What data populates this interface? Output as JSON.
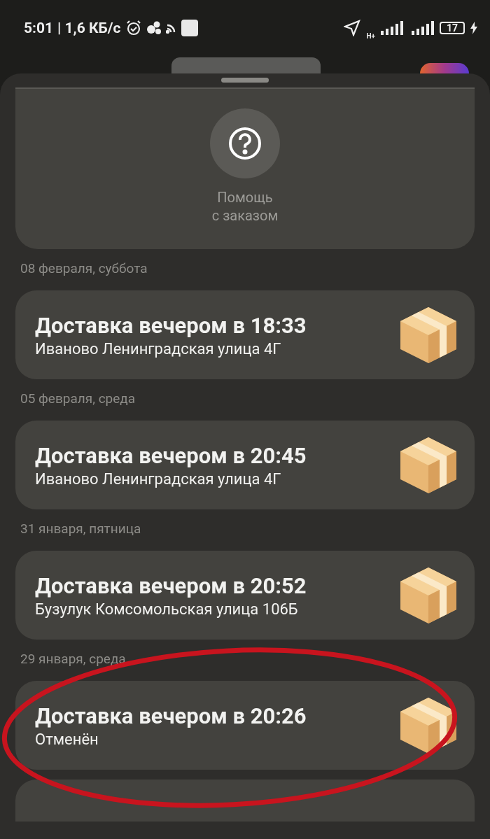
{
  "status_bar": {
    "time": "5:01",
    "speed": "| 1,6 КБ/с",
    "network": "H+",
    "battery": "17"
  },
  "help": {
    "label": "Помощь\nс заказом"
  },
  "orders": [
    {
      "date": "08 февраля, суббота",
      "title": "Доставка вечером в 18:33",
      "subtitle": "Иваново Ленинградская улица 4Г"
    },
    {
      "date": "05 февраля, среда",
      "title": "Доставка вечером в 20:45",
      "subtitle": "Иваново Ленинградская улица 4Г"
    },
    {
      "date": "31 января, пятница",
      "title": "Доставка вечером в 20:52",
      "subtitle": "Бузулук Комсомольская улица 106Б"
    },
    {
      "date": "29 января, среда",
      "title": "Доставка вечером в 20:26",
      "subtitle": "Отменён"
    }
  ],
  "annotation": {
    "color": "#c8141e"
  }
}
